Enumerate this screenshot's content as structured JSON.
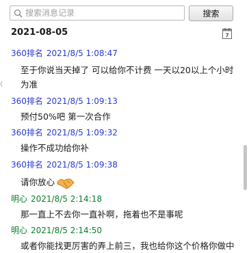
{
  "search": {
    "placeholder": "搜索消息记录",
    "button_label": "搜索"
  },
  "date_heading": "2021-08-05",
  "colors": {
    "other_sender": "#2a3ad0",
    "self_sender": "#0a7d2a"
  },
  "messages": [
    {
      "sender": "360排名",
      "time": "2021/8/5 1:08:47",
      "text": "至于你说当天掉了 可以给你不计费 一天以20以上个小时为准",
      "self": false
    },
    {
      "sender": "360排名",
      "time": "2021/8/5 1:09:13",
      "text": "预付50%吧 第一次合作",
      "self": false
    },
    {
      "sender": "360排名",
      "time": "2021/8/5 1:09:32",
      "text": "操作不成功给你补",
      "self": false
    },
    {
      "sender": "360排名",
      "time": "2021/8/5 1:09:38",
      "text": "请你放心",
      "self": false,
      "emoji": "handshake-icon"
    },
    {
      "sender": "明心",
      "time": "2021/8/5 2:14:18",
      "text": "那一直上不去你一直补啊，拖着也不是事呢",
      "self": true
    },
    {
      "sender": "明心",
      "time": "2021/8/5 2:14:50",
      "text": "或者你能找更厉害的弄上前三，我也给你这个价格你做中",
      "self": true
    }
  ]
}
